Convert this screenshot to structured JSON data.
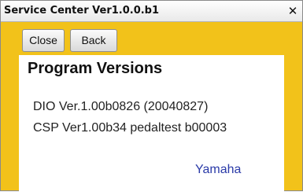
{
  "window": {
    "title": "Service Center Ver1.0.0.b1",
    "close_glyph": "✕",
    "close_icon": "close-icon"
  },
  "toolbar": {
    "close_label": "Close",
    "back_label": "Back"
  },
  "panel": {
    "title": "Program Versions",
    "versions": [
      "DIO Ver.1.00b0826 (20040827)",
      "CSP Ver1.00b34 pedaltest b00003"
    ],
    "brand": "Yamaha"
  },
  "colors": {
    "frame_background": "#f2c21a",
    "panel_background": "#ffffff",
    "brand_text": "#2a3aa8"
  }
}
